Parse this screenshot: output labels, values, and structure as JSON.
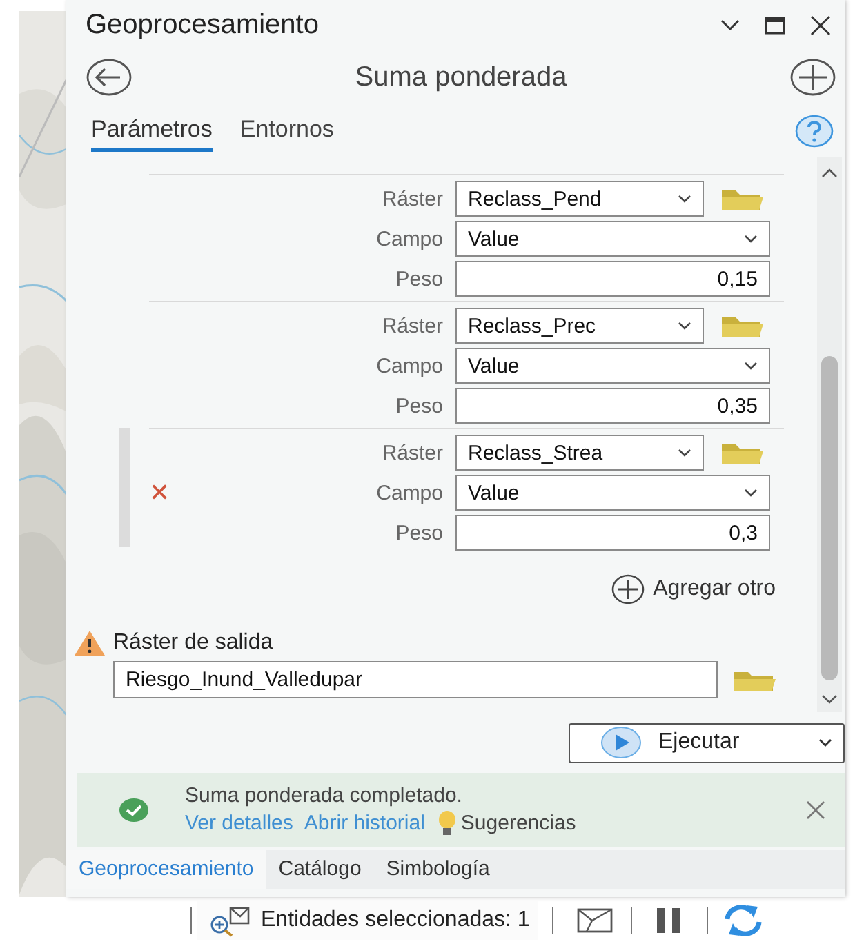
{
  "title": "Geoprocesamiento",
  "tool": "Suma ponderada",
  "tabs": [
    {
      "label": "Parámetros",
      "selected": true
    },
    {
      "label": "Entornos",
      "selected": false
    }
  ],
  "groups": [
    {
      "selected": false,
      "rows": [
        {
          "kind": "raster",
          "label": "Ráster",
          "value": "Reclass_Pend"
        },
        {
          "kind": "field",
          "label": "Campo",
          "value": "Value"
        },
        {
          "kind": "weight",
          "label": "Peso",
          "value": "0,15"
        }
      ]
    },
    {
      "selected": false,
      "rows": [
        {
          "kind": "raster",
          "label": "Ráster",
          "value": "Reclass_Prec"
        },
        {
          "kind": "field",
          "label": "Campo",
          "value": "Value"
        },
        {
          "kind": "weight",
          "label": "Peso",
          "value": "0,35"
        }
      ]
    },
    {
      "selected": true,
      "remove": "✕",
      "rows": [
        {
          "kind": "raster",
          "label": "Ráster",
          "value": "Reclass_Strea"
        },
        {
          "kind": "field",
          "label": "Campo",
          "value": "Value"
        },
        {
          "kind": "weight",
          "label": "Peso",
          "value": "0,3"
        }
      ]
    }
  ],
  "add_button": "Agregar otro",
  "output": {
    "label": "Ráster de salida",
    "value": "Riesgo_Inund_Valledupar",
    "warning": true
  },
  "run_button": "Ejecutar",
  "message": {
    "text": "Suma ponderada completado.",
    "links": [
      "Ver detalles",
      "Abrir historial",
      "Sugerencias"
    ]
  },
  "bottom_tabs": [
    {
      "label": "Geoprocesamiento",
      "selected": true
    },
    {
      "label": "Catálogo",
      "selected": false
    },
    {
      "label": "Simbología",
      "selected": false
    }
  ],
  "status_bar": {
    "selection": "Entidades seleccionadas: 1"
  }
}
